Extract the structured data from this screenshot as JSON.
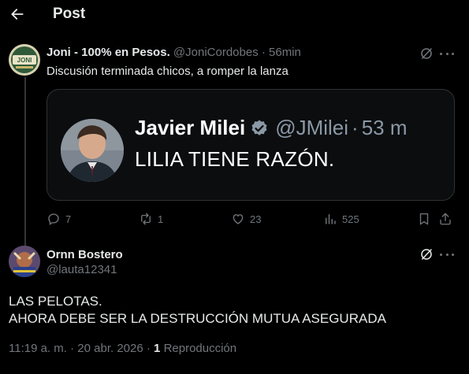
{
  "header": {
    "title": "Post"
  },
  "post1": {
    "author_name": "Joni - 100% en Pesos.",
    "handle": "@JoniCordobes",
    "separator": "·",
    "time": "56min",
    "text": "Discusión terminada chicos, a romper la lanza",
    "avatar_label": "JONI",
    "quote": {
      "name": "Javier Milei",
      "handle": "@JMilei",
      "separator": "·",
      "time": "53 m",
      "text": "LILIA TIENE RAZÓN."
    },
    "actions": {
      "replies": "7",
      "reposts": "1",
      "likes": "23",
      "views": "525"
    }
  },
  "post2": {
    "author_name": "Ornn Bostero",
    "handle": "@lauta12341",
    "text_lines": [
      "LAS PELOTAS.",
      "AHORA DEBE SER LA DESTRUCCIÓN MUTUA ASEGURADA"
    ],
    "meta": {
      "time": "11:19 a. m.",
      "separator": "·",
      "date": "20 abr. 2026",
      "separator2": "·",
      "views_count": "1",
      "views_label": "Reproducción"
    }
  },
  "colors": {
    "background": "#000000",
    "text": "#e7e9ea",
    "muted": "#71767b",
    "border": "#2f3336",
    "verified": "#1d9bf0"
  }
}
